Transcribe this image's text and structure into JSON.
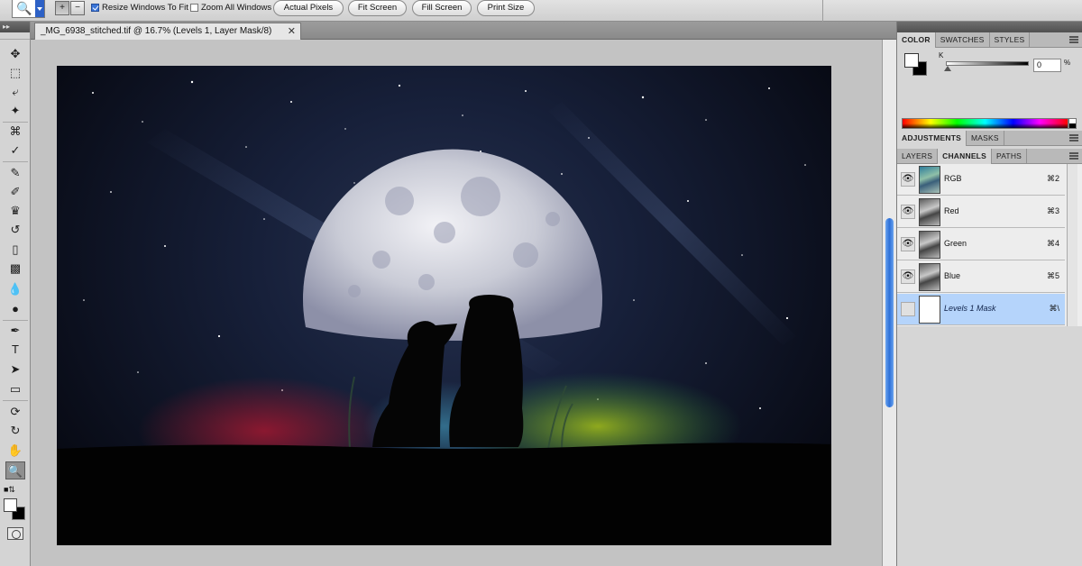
{
  "options_bar": {
    "resize_windows_label": "Resize Windows To Fit",
    "resize_windows_checked": true,
    "zoom_all_label": "Zoom All Windows",
    "zoom_all_checked": false,
    "actual_pixels_label": "Actual Pixels",
    "fit_screen_label": "Fit Screen",
    "fill_screen_label": "Fill Screen",
    "print_size_label": "Print Size"
  },
  "document": {
    "tab_title": "_MG_6938_stitched.tif @ 16.7% (Levels 1, Layer Mask/8)",
    "close_glyph": "✕"
  },
  "color_panel": {
    "tabs": [
      "COLOR",
      "SWATCHES",
      "STYLES"
    ],
    "active_tab": "COLOR",
    "channel_label": "K",
    "k_value": "0",
    "k_unit": "%",
    "foreground": "#ffffff",
    "background": "#000000"
  },
  "adjustments_panel": {
    "tabs": [
      "ADJUSTMENTS",
      "MASKS"
    ],
    "active_tab": "ADJUSTMENTS"
  },
  "layers_panel": {
    "tabs": [
      "LAYERS",
      "CHANNELS",
      "PATHS"
    ],
    "active_tab": "CHANNELS",
    "channels": [
      {
        "name": "RGB",
        "shortcut": "⌘2",
        "visible": true,
        "thumb": "rgb"
      },
      {
        "name": "Red",
        "shortcut": "⌘3",
        "visible": true,
        "thumb": "gray"
      },
      {
        "name": "Green",
        "shortcut": "⌘4",
        "visible": true,
        "thumb": "gray"
      },
      {
        "name": "Blue",
        "shortcut": "⌘5",
        "visible": true,
        "thumb": "gray"
      },
      {
        "name": "Levels 1 Mask",
        "shortcut": "⌘\\",
        "visible": false,
        "thumb": "mask",
        "selected": true
      }
    ]
  },
  "tools": [
    "move-tool",
    "marquee-tool",
    "lasso-tool",
    "quick-selection-tool",
    "crop-tool",
    "eyedropper-tool",
    "healing-brush-tool",
    "brush-tool",
    "clone-stamp-tool",
    "history-brush-tool",
    "eraser-tool",
    "gradient-tool",
    "blur-tool",
    "dodge-tool",
    "pen-tool",
    "type-tool",
    "path-selection-tool",
    "rectangle-tool",
    "3d-rotate-tool",
    "3d-orbit-tool",
    "hand-tool",
    "zoom-tool"
  ],
  "active_tool": "zoom-tool",
  "colors": {
    "accent_blue": "#2d6fd8",
    "selection_row": "#b5d4fb"
  }
}
